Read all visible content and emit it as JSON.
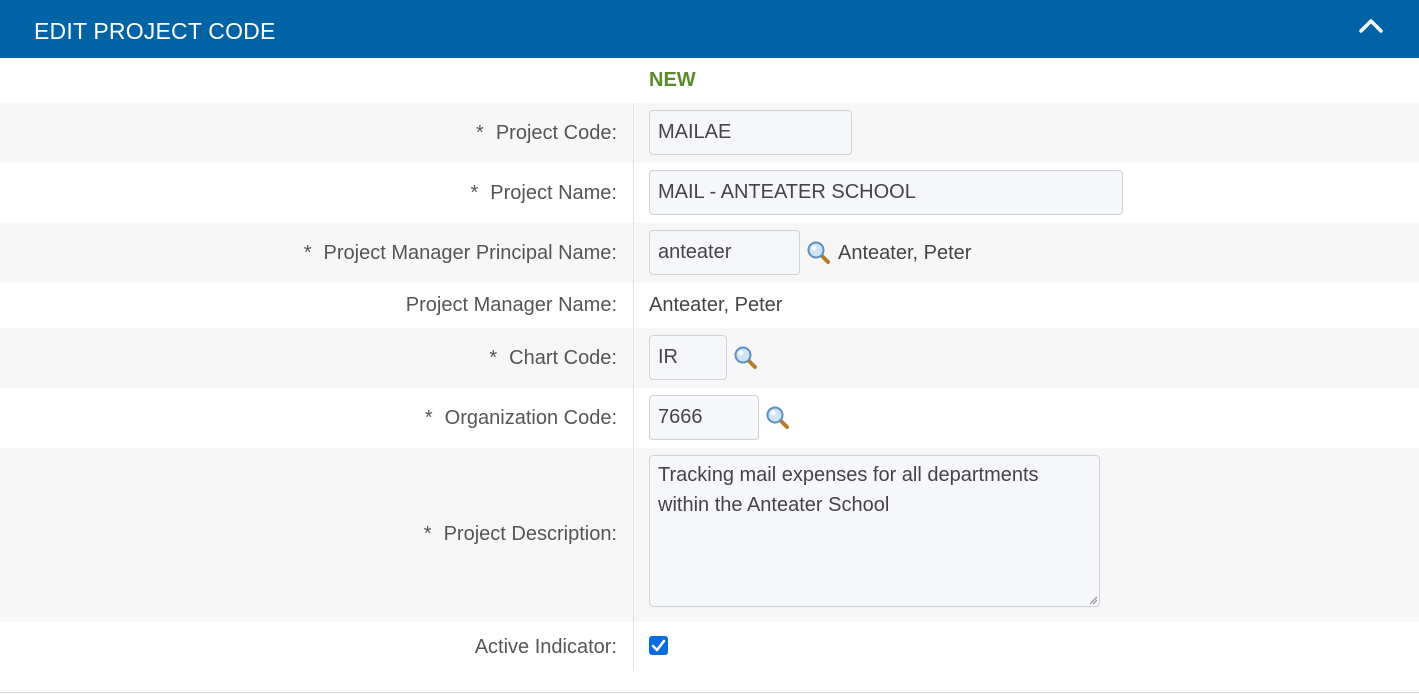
{
  "header": {
    "title": "EDIT PROJECT CODE",
    "collapse_icon": "chevron-up-icon"
  },
  "status": "NEW",
  "colors": {
    "header": "#0063a6",
    "status": "#5a8a2c",
    "checkbox": "#0a6cde"
  },
  "fields": {
    "project_code": {
      "required": "*",
      "label": "Project Code:",
      "value": "MAILAE"
    },
    "project_name": {
      "required": "*",
      "label": "Project Name:",
      "value": "MAIL - ANTEATER SCHOOL"
    },
    "pm_principal": {
      "required": "*",
      "label": "Project Manager Principal Name:",
      "value": "anteater",
      "lookup_result": "Anteater, Peter"
    },
    "pm_name": {
      "label": "Project Manager Name:",
      "value": "Anteater, Peter"
    },
    "chart_code": {
      "required": "*",
      "label": "Chart Code:",
      "value": "IR"
    },
    "org_code": {
      "required": "*",
      "label": "Organization Code:",
      "value": "7666"
    },
    "description": {
      "required": "*",
      "label": "Project Description:",
      "value": "Tracking mail expenses for all departments within the Anteater School"
    },
    "active": {
      "label": "Active Indicator:",
      "checked": true
    }
  }
}
